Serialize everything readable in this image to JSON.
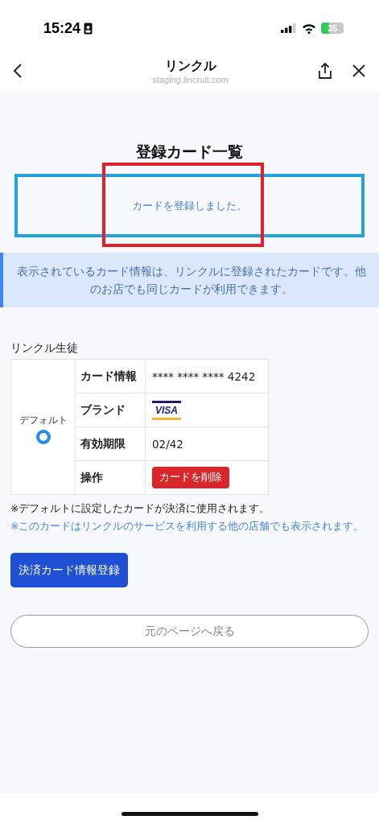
{
  "status_bar": {
    "time": "15:24",
    "battery": "35"
  },
  "nav": {
    "title": "リンクル",
    "url": "staging.lincruit.com"
  },
  "page": {
    "title": "登録カード一覧",
    "flash": "カードを登録しました。",
    "info": "表示されているカード情報は、リンクルに登録されたカードです。他のお店でも同じカードが利用できます。",
    "owner": "リンクル生徒"
  },
  "annotations": [
    {
      "kind": "outline",
      "color": "#e0202a"
    }
  ],
  "cards": [
    {
      "default_label": "デフォルト",
      "selected": true,
      "rows": [
        {
          "kind": "text",
          "label": "カード情報",
          "value": "**** **** **** 4242"
        },
        {
          "kind": "brand",
          "label": "ブランド",
          "value": "VISA"
        },
        {
          "kind": "text",
          "label": "有効期限",
          "value": "02/42"
        },
        {
          "kind": "action",
          "label": "操作",
          "value": "カードを削除"
        }
      ]
    }
  ],
  "notes": [
    {
      "kind": "plain",
      "text": "※デフォルトに設定したカードが決済に使用されます。"
    },
    {
      "kind": "link",
      "text": "※このカードはリンクルのサービスを利用する他の店舗でも表示されます。"
    }
  ],
  "buttons": [
    {
      "kind": "primary",
      "label": "決済カード情報登録"
    },
    {
      "kind": "outline",
      "label": "元のページへ戻る"
    }
  ]
}
